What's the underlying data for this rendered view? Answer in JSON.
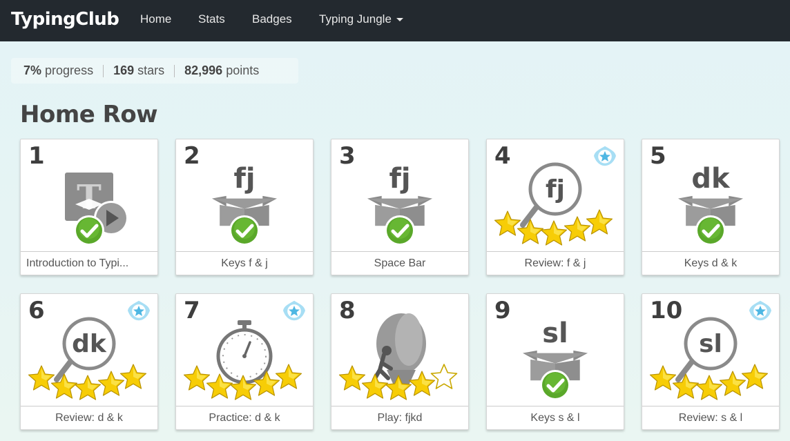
{
  "nav": {
    "brand": "TypingClub",
    "links": [
      "Home",
      "Stats",
      "Badges",
      "Typing Jungle"
    ]
  },
  "stats": {
    "progress_value": "7%",
    "progress_label": "progress",
    "stars_value": "169",
    "stars_label": "stars",
    "points_value": "82,996",
    "points_label": "points"
  },
  "section": {
    "title": "Home Row"
  },
  "lessons": [
    {
      "num": "1",
      "name": "Introduction to Typi...",
      "icon": "video-lesson-icon",
      "status": "complete",
      "stars": null,
      "badge": false
    },
    {
      "num": "2",
      "name": "Keys f & j",
      "keys": "fj",
      "icon": "open-box-icon",
      "status": "complete",
      "stars": null,
      "badge": false
    },
    {
      "num": "3",
      "name": "Space Bar",
      "keys": "fj",
      "icon": "open-box-icon",
      "status": "complete",
      "stars": null,
      "badge": false
    },
    {
      "num": "4",
      "name": "Review: f & j",
      "keys": "fj",
      "icon": "magnifier-icon",
      "status": "stars",
      "stars": 5,
      "badge": true
    },
    {
      "num": "5",
      "name": "Keys d & k",
      "keys": "dk",
      "icon": "open-box-icon",
      "status": "complete",
      "stars": null,
      "badge": false
    },
    {
      "num": "6",
      "name": "Review: d & k",
      "keys": "dk",
      "icon": "magnifier-icon",
      "status": "stars",
      "stars": 5,
      "badge": true
    },
    {
      "num": "7",
      "name": "Practice: d & k",
      "icon": "stopwatch-icon",
      "status": "stars",
      "stars": 5,
      "badge": true
    },
    {
      "num": "8",
      "name": "Play: fjkd",
      "icon": "balloon-game-icon",
      "status": "stars",
      "stars": 4,
      "badge": false
    },
    {
      "num": "9",
      "name": "Keys s & l",
      "keys": "sl",
      "icon": "open-box-icon",
      "status": "complete",
      "stars": null,
      "badge": false
    },
    {
      "num": "10",
      "name": "Review: s & l",
      "keys": "sl",
      "icon": "magnifier-icon",
      "status": "stars",
      "stars": 5,
      "badge": true
    }
  ],
  "colors": {
    "navbar": "#23292f",
    "check_green": "#5ca829",
    "star_gold": "#f5c800",
    "badge_blue": "#5bc0e8",
    "icon_gray": "#7d7d7d"
  }
}
